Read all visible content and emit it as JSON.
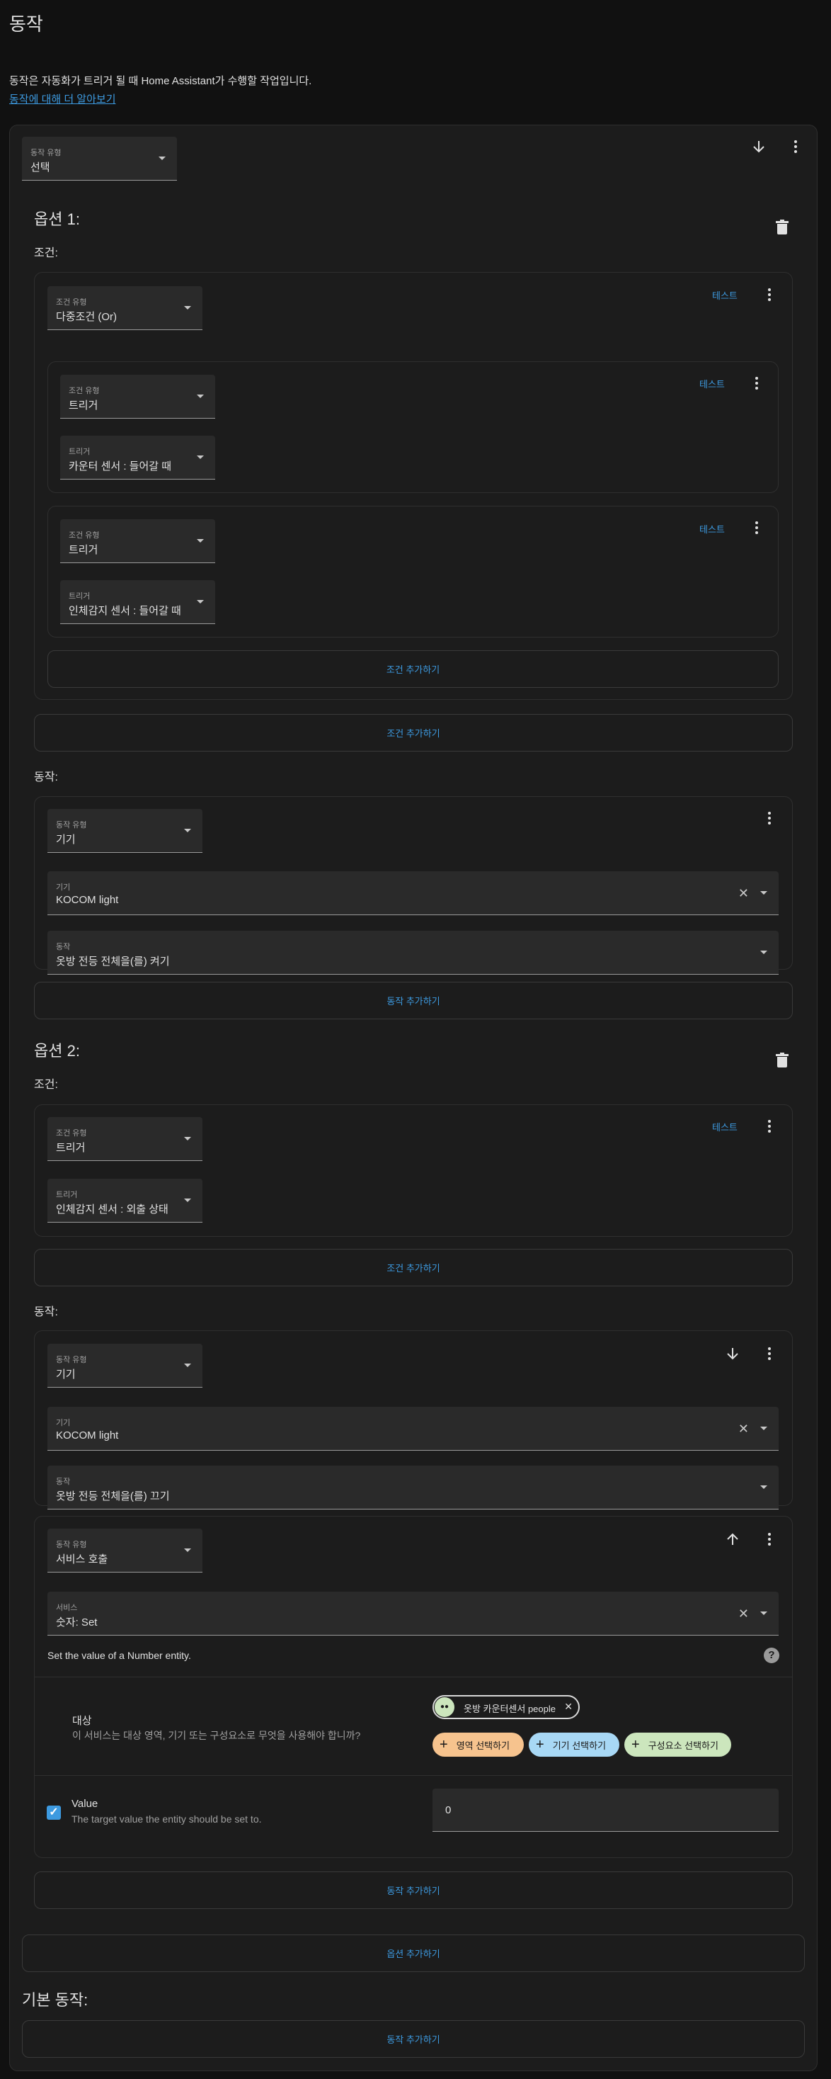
{
  "page": {
    "title": "동작",
    "description": "동작은 자동화가 트리거 될 때 Home Assistant가 수행할 작업입니다.",
    "learn_more": "동작에 대해 더 알아보기"
  },
  "choose": {
    "type_label": "동작 유형",
    "type_value": "선택"
  },
  "option1": {
    "title": "옵션 1:",
    "conditions_label": "조건:",
    "or_cond": {
      "type_label": "조건 유형",
      "type_value": "다중조건 (Or)",
      "test": "테스트",
      "sub1": {
        "type_label": "조건 유형",
        "type_value": "트리거",
        "trigger_label": "트리거",
        "trigger_value": "카운터 센서 : 들어갈 때",
        "test": "테스트"
      },
      "sub2": {
        "type_label": "조건 유형",
        "type_value": "트리거",
        "trigger_label": "트리거",
        "trigger_value": "인체감지 센서 : 들어갈 때",
        "test": "테스트"
      },
      "add_inner": "조건 추가하기"
    },
    "add_condition": "조건 추가하기",
    "actions_label": "동작:",
    "action1": {
      "type_label": "동작 유형",
      "type_value": "기기",
      "device_label": "기기",
      "device_value": "KOCOM light",
      "action_label": "동작",
      "action_value": "옷방 전등 전체을(를) 켜기"
    },
    "add_action": "동작 추가하기"
  },
  "option2": {
    "title": "옵션 2:",
    "conditions_label": "조건:",
    "cond": {
      "type_label": "조건 유형",
      "type_value": "트리거",
      "trigger_label": "트리거",
      "trigger_value": "인체감지 센서 : 외출 상태",
      "test": "테스트"
    },
    "add_condition": "조건 추가하기",
    "actions_label": "동작:",
    "action1": {
      "type_label": "동작 유형",
      "type_value": "기기",
      "device_label": "기기",
      "device_value": "KOCOM light",
      "action_label": "동작",
      "action_value": "옷방 전등 전체을(를) 끄기"
    },
    "action2": {
      "type_label": "동작 유형",
      "type_value": "서비스 호출",
      "service_label": "서비스",
      "service_value": "숫자: Set",
      "service_desc": "Set the value of a Number entity.",
      "target_title": "대상",
      "target_desc": "이 서비스는 대상 영역, 기기 또는 구성요소로 무엇을 사용해야 합니까?",
      "target_chip": "옷방 카운터센서 people",
      "choose_area": "영역 선택하기",
      "choose_device": "기기 선택하기",
      "choose_entity": "구성요소 선택하기",
      "value_title": "Value",
      "value_desc": "The target value the entity should be set to.",
      "value_input": "0"
    },
    "add_action": "동작 추가하기"
  },
  "add_option": "옵션 추가하기",
  "default": {
    "title": "기본 동작:",
    "add_action": "동작 추가하기"
  },
  "colors": {
    "accent": "#3d9ae0",
    "area_chip": "#f6c38e",
    "device_chip": "#a8d8f5",
    "entity_chip": "#cce6bd"
  }
}
